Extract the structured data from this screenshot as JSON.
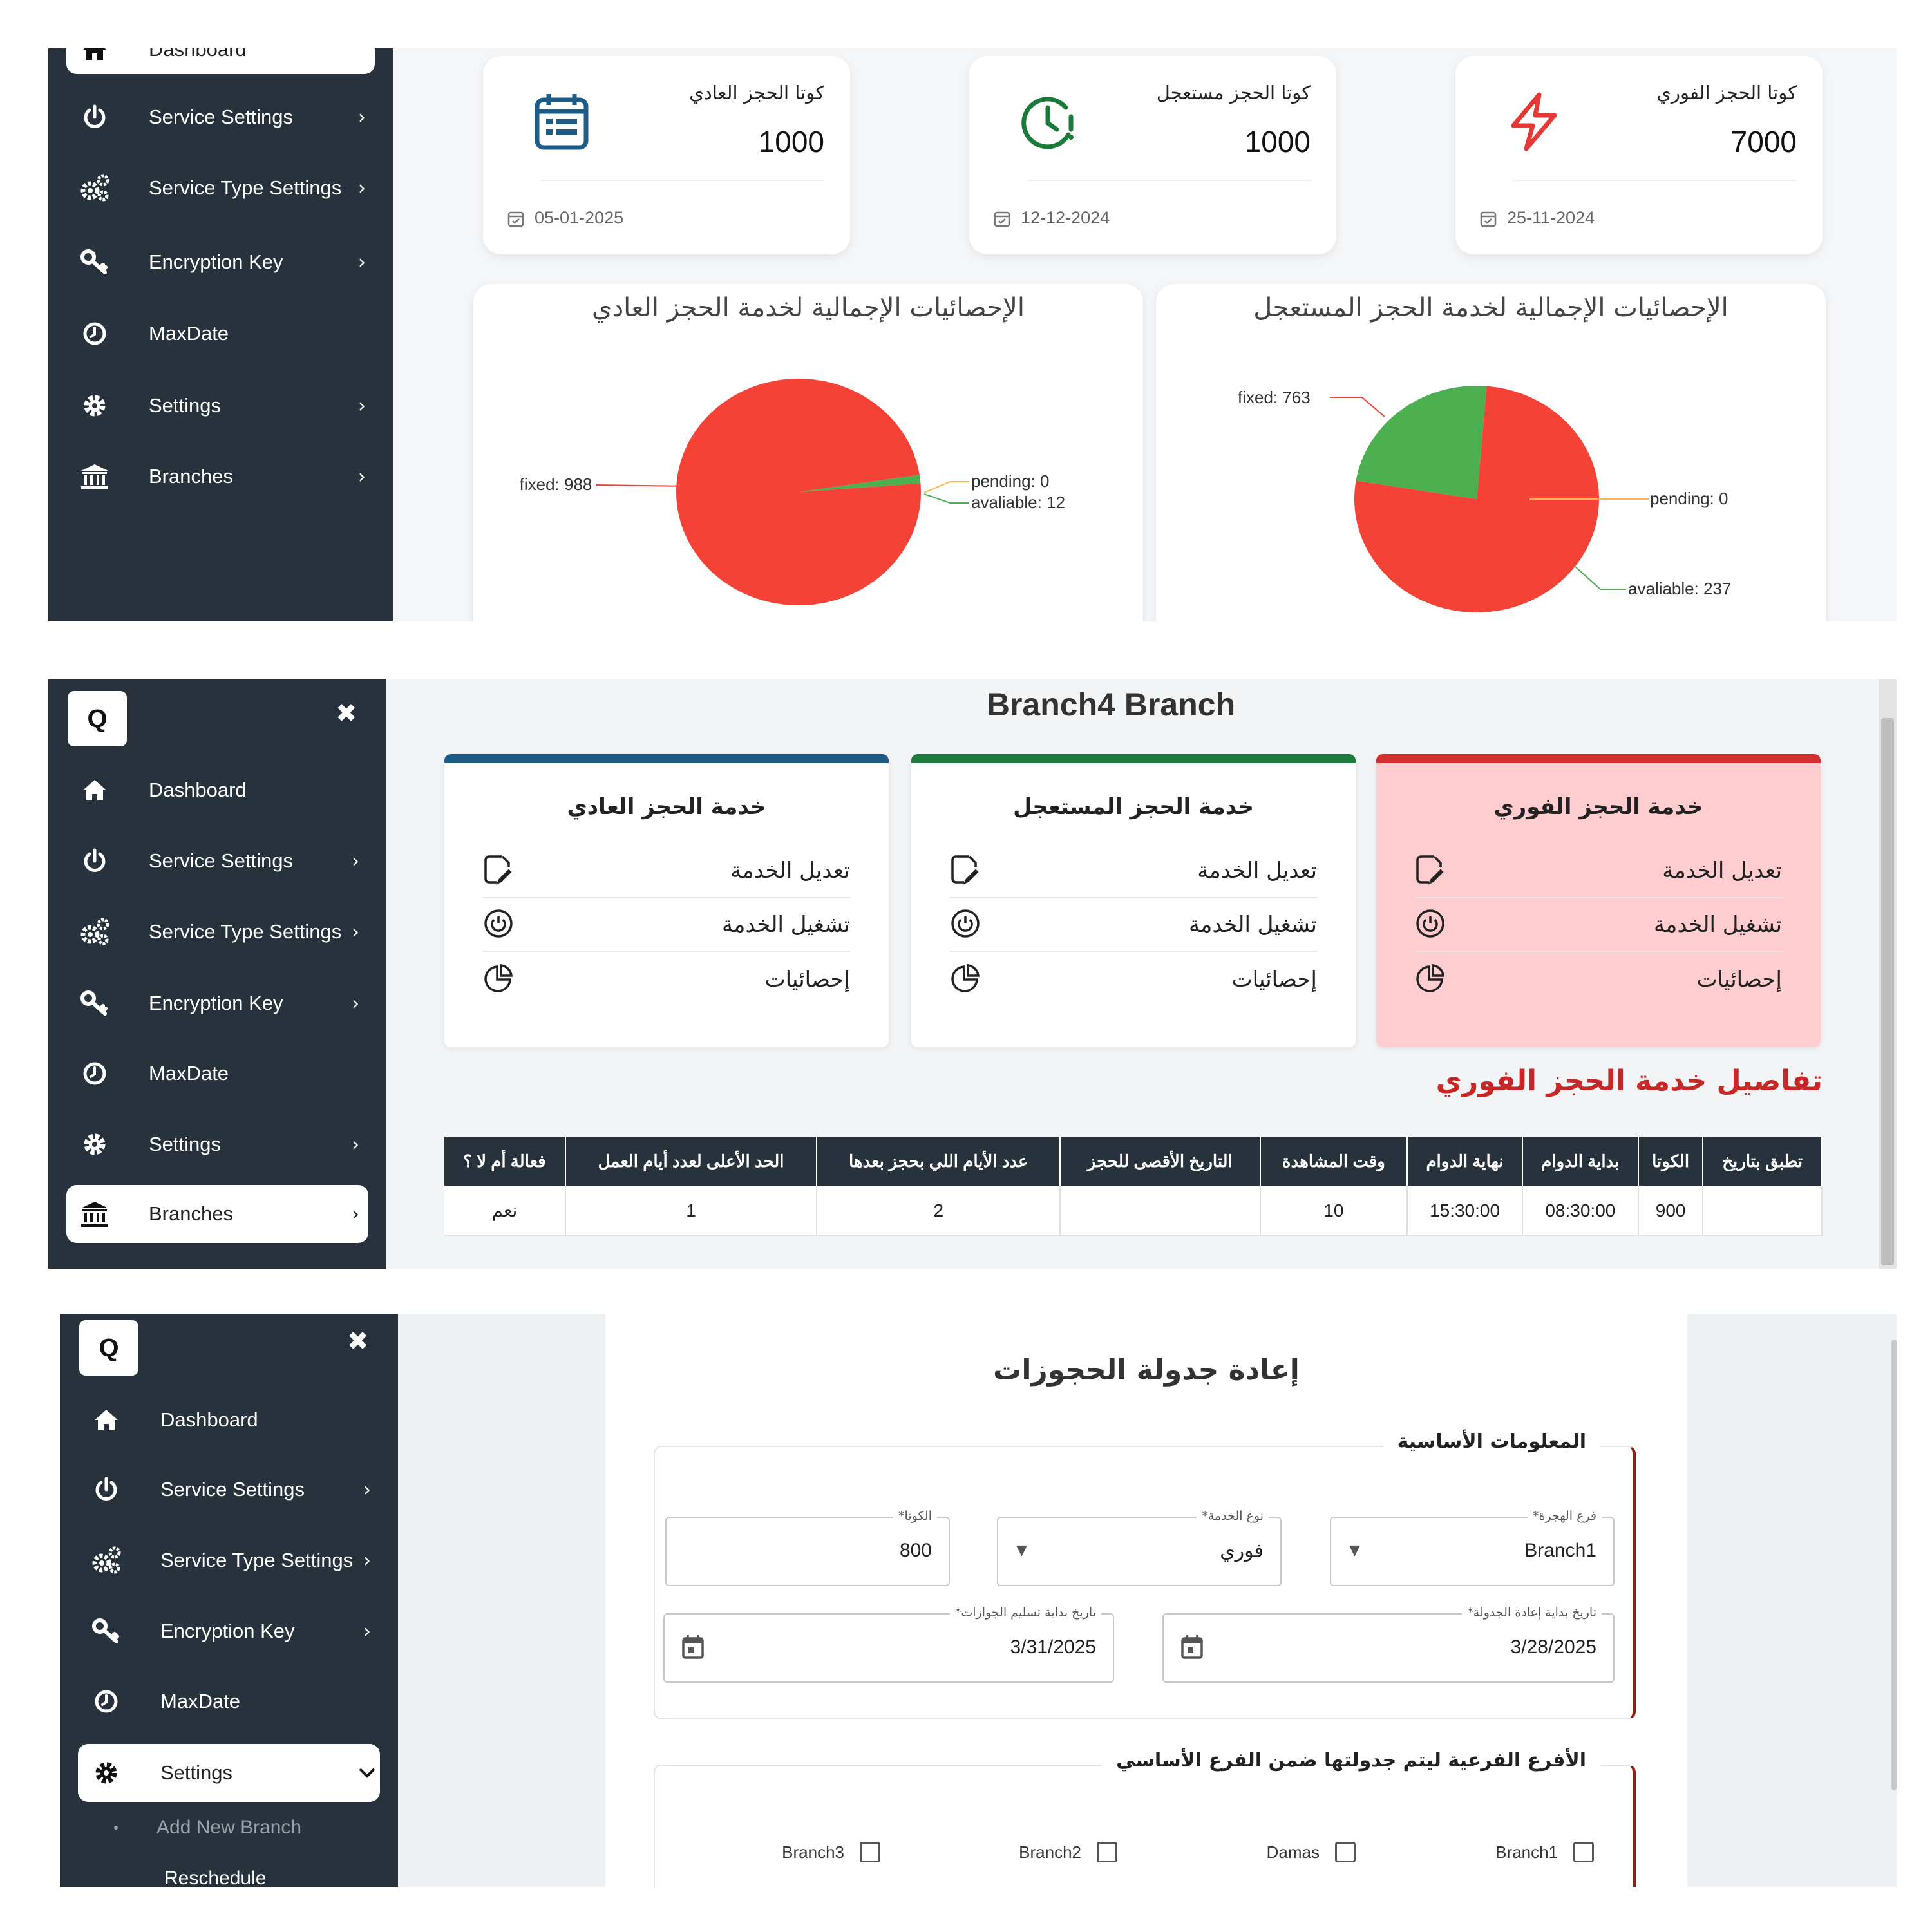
{
  "sidebar": {
    "logo": "Q",
    "close": "✖",
    "items": [
      {
        "label": "Dashboard"
      },
      {
        "label": "Service Settings"
      },
      {
        "label": "Service Type Settings"
      },
      {
        "label": "Encryption Key"
      },
      {
        "label": "MaxDate"
      },
      {
        "label": "Settings"
      },
      {
        "label": "Branches"
      }
    ],
    "chevron": "›",
    "chevron_down": "⌄",
    "submenu": {
      "add_branch": "Add New Branch",
      "reschedule": "Reschedule"
    }
  },
  "panel1": {
    "quota_cards": [
      {
        "title": "كوتا الحجز العادي",
        "value": "1000",
        "date": "05-01-2025",
        "icon": "calendar-icon",
        "color": "#1c5c86"
      },
      {
        "title": "كوتا الحجز مستعجل",
        "value": "1000",
        "date": "12-12-2024",
        "icon": "clock-alert-icon",
        "color": "#1a7a3a"
      },
      {
        "title": "كوتا الحجز الفوري",
        "value": "7000",
        "date": "25-11-2024",
        "icon": "lightning-icon",
        "color": "#e53935"
      }
    ],
    "chart_titles": {
      "regular": "الإحصائيات الإجمالية لخدمة الحجز العادي",
      "urgent": "الإحصائيات الإجمالية لخدمة الحجز المستعجل"
    },
    "chart_labels": {
      "regular_fixed": "fixed: 988",
      "regular_pending": "pending: 0",
      "regular_available": "avaliable: 12",
      "urgent_fixed": "fixed: 763",
      "urgent_pending": "pending: 0",
      "urgent_available": "avaliable: 237"
    }
  },
  "chart_data": [
    {
      "type": "pie",
      "title": "الإحصائيات الإجمالية لخدمة الحجز العادي",
      "categories": [
        "fixed",
        "pending",
        "avaliable"
      ],
      "values": [
        988,
        0,
        12
      ],
      "colors": [
        "#f44336",
        "#ffb74d",
        "#4caf50"
      ]
    },
    {
      "type": "pie",
      "title": "الإحصائيات الإجمالية لخدمة الحجز المستعجل",
      "categories": [
        "fixed",
        "pending",
        "avaliable"
      ],
      "values": [
        763,
        0,
        237
      ],
      "colors": [
        "#f44336",
        "#ffb74d",
        "#4caf50"
      ]
    }
  ],
  "panel2": {
    "title": "Branch4 Branch",
    "services": [
      {
        "title": "خدمة الحجز العادي",
        "color": "#1c5c86",
        "bg": "#ffffff"
      },
      {
        "title": "خدمة الحجز المستعجل",
        "color": "#1e7a3c",
        "bg": "#ffffff"
      },
      {
        "title": "خدمة الحجز الفوري",
        "color": "#d32f2f",
        "bg": "#ffcdd0"
      }
    ],
    "actions": {
      "edit": "تعديل الخدمة",
      "run": "تشغيل الخدمة",
      "stats": "إحصائيات"
    },
    "details_title": "تفاصيل خدمة الحجز الفوري",
    "table": {
      "headers": [
        "تطبق بتاريخ",
        "الكوتا",
        "بداية الدوام",
        "نهاية الدوام",
        "وقت المشاهدة",
        "التاريخ الأقصى للحجز",
        "عدد الأيام اللي بحجز بعدها",
        "الحد الأعلى لعدد أيام العمل",
        "فعالة أم لا ؟"
      ],
      "row": [
        "",
        "900",
        "08:30:00",
        "15:30:00",
        "10",
        "",
        "2",
        "1",
        "نعم"
      ]
    }
  },
  "panel3": {
    "title": "إعادة جدولة الحجوزات",
    "basic_legend": "المعلومات الأساسية",
    "fields": {
      "branch_label": "فرع الهجرة*",
      "branch_value": "Branch1",
      "service_label": "نوع الخدمة*",
      "service_value": "فوري",
      "quota_label": "الكوتا*",
      "quota_value": "800",
      "resched_label": "تاريخ بداية إعادة الجدولة*",
      "resched_value": "3/28/2025",
      "delivery_label": "تاريخ بداية تسليم الجوازات*",
      "delivery_value": "3/31/2025"
    },
    "sub_legend": "الأفرع الفرعية ليتم جدولتها ضمن الفرع الأساسي",
    "checkboxes": [
      "Branch1",
      "Damas",
      "Branch2",
      "Branch3"
    ]
  }
}
